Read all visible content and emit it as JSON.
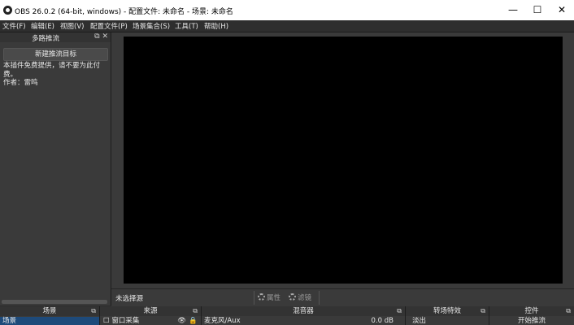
{
  "window": {
    "title": "OBS 26.0.2 (64-bit, windows) - 配置文件: 未命名 - 场景: 未命名",
    "minimize": "—",
    "maximize": "☐",
    "close": "✕"
  },
  "menu": [
    "文件(F)",
    "编辑(E)",
    "视图(V)",
    "配置文件(P)",
    "场景集合(S)",
    "工具(T)",
    "帮助(H)"
  ],
  "stream_dock": {
    "title": "多路推流",
    "new_target": "新建推流目标",
    "desc_line1": "本插件免费提供，请不要为此付费。",
    "desc_line2": "作者：雷鸣"
  },
  "status_bar": {
    "no_source": "未选择源",
    "properties": "属性",
    "filters": "滤镜"
  },
  "docks": {
    "scenes": {
      "title": "场景",
      "item": "场景"
    },
    "sources": {
      "title": "来源",
      "item": "窗口采集"
    },
    "mixer": {
      "title": "混音器",
      "item": "麦克风/Aux",
      "level": "0.0 dB"
    },
    "transitions": {
      "title": "转场特效",
      "item": "淡出"
    },
    "controls": {
      "title": "控件",
      "item": "开始推流"
    }
  }
}
